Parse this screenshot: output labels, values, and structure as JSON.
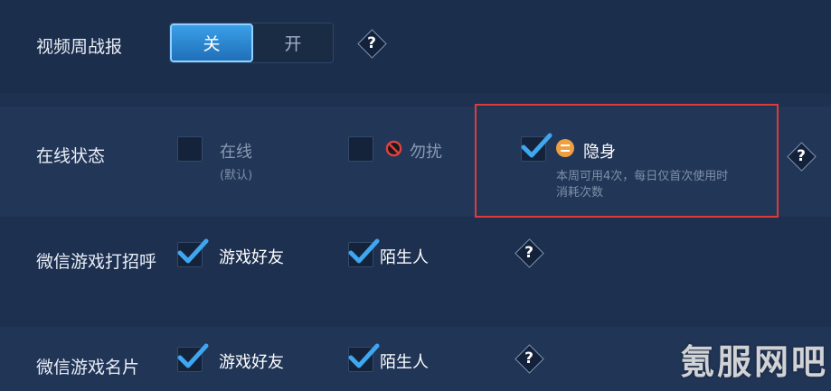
{
  "weekly_report": {
    "label": "视频周战报",
    "toggle_off": "关",
    "toggle_on": "开",
    "selected": "关",
    "help": "?"
  },
  "online_status": {
    "label": "在线状态",
    "options": [
      {
        "label": "在线",
        "sub": "(默认)",
        "checked": false,
        "icon": ""
      },
      {
        "label": "勿扰",
        "sub": "",
        "checked": false,
        "icon": "do-not-disturb-icon"
      },
      {
        "label": "隐身",
        "sub_line1": "本周可用4次，每日仅首次使用时",
        "sub_line2": "消耗次数",
        "checked": true,
        "icon": "invisible-icon"
      }
    ],
    "help": "?"
  },
  "wechat_greeting": {
    "label": "微信游戏打招呼",
    "options": [
      {
        "label": "游戏好友",
        "checked": true
      },
      {
        "label": "陌生人",
        "checked": true
      }
    ],
    "help": "?"
  },
  "wechat_card": {
    "label": "微信游戏名片",
    "options": [
      {
        "label": "游戏好友",
        "checked": true
      },
      {
        "label": "陌生人",
        "checked": true
      }
    ],
    "help": "?"
  },
  "watermark": "氪服网吧",
  "colors": {
    "accent": "#3aa0e8",
    "highlight_box": "#e03a3a",
    "invisible_icon": "#f0a040",
    "dnd_icon": "#e04040"
  }
}
